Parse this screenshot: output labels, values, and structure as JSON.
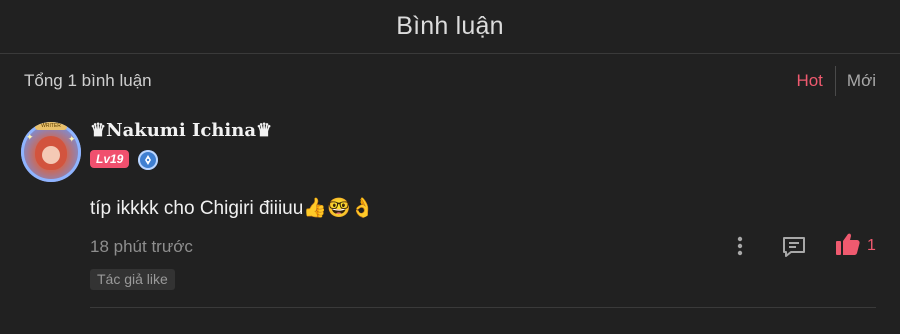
{
  "header": {
    "title": "Bình luận"
  },
  "summary": {
    "total_label": "Tổng 1 bình luận",
    "sort_tabs": [
      {
        "label": "Hot",
        "active": true
      },
      {
        "label": "Mới",
        "active": false
      }
    ]
  },
  "comment": {
    "username": "♛Nakumi Ichina♛",
    "avatar_banner_text": "WRITER",
    "level": "Lv19",
    "text": "típ ikkkk cho Chigiri điiiuu👍🤓👌",
    "time": "18 phút trước",
    "like_count": "1",
    "author_tag": "Tác giả like",
    "icons": [
      "more-vertical-icon",
      "reply-icon",
      "thumbs-up-icon",
      "pen-badge-icon"
    ]
  },
  "colors": {
    "accent": "#ef5a6f",
    "background": "#212121",
    "level_badge": "#f0506e",
    "role_badge": "#3f7fd1"
  }
}
